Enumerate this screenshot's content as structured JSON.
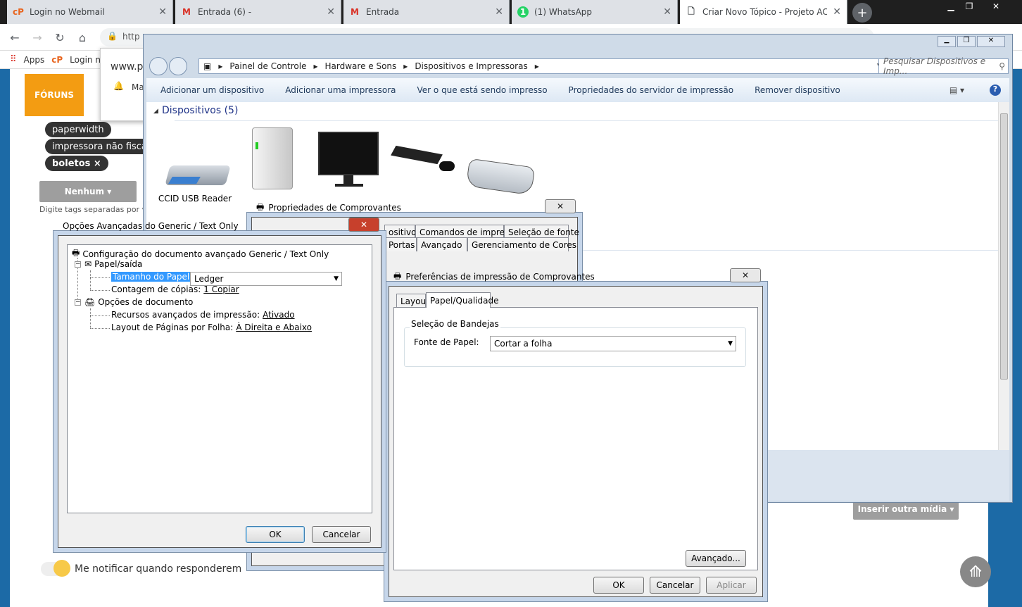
{
  "browser": {
    "tabs": [
      {
        "title": "Login no Webmail",
        "icon": "cp-icon",
        "color": "#e8651f"
      },
      {
        "title": "Entrada (6) - ",
        "icon": "gmail-icon",
        "color": "#d93025"
      },
      {
        "title": "Entrada",
        "icon": "gmail-icon",
        "color": "#d93025"
      },
      {
        "title": "(1) WhatsApp",
        "icon": "whatsapp-icon",
        "color": "#25d366"
      },
      {
        "title": "Criar Novo Tópico - Projeto ACBr",
        "icon": "page-icon",
        "color": "#5f6368"
      }
    ],
    "new_tab": "+",
    "url_prefix": "http",
    "bookmarks": {
      "apps": "Apps",
      "login": "Login n"
    }
  },
  "page": {
    "forum_button": "FÓRUNS",
    "popup": {
      "site": "www.p",
      "notif": "Ma"
    },
    "tags": [
      "paperwidth",
      "impressora não fiscal",
      "boletos ×"
    ],
    "nenhum": "Nenhum ▾",
    "tag_hint": "Digite tags separadas por v",
    "notify_label": "Me notificar quando responderem",
    "insert_media": "Inserir outra mídia ▾",
    "to_top": "⟰"
  },
  "explorer": {
    "breadcrumb": [
      "Painel de Controle",
      "Hardware e Sons",
      "Dispositivos e Impressoras"
    ],
    "search_placeholder": "Pesquisar Dispositivos e Imp...",
    "commands": [
      "Adicionar um dispositivo",
      "Adicionar uma impressora",
      "Ver o que está sendo impresso",
      "Propriedades do servidor de impressão",
      "Remover dispositivo"
    ],
    "group_title": "Dispositivos (5)",
    "devices": [
      {
        "name": "CCID USB Reader",
        "icon": "card-reader-icon"
      },
      {
        "name": "",
        "icon": "external-drive-icon"
      },
      {
        "name": "",
        "icon": "monitor-icon"
      },
      {
        "name": "",
        "icon": "keyboard-mouse-icon"
      },
      {
        "name": "",
        "icon": "keyboard-icon"
      }
    ]
  },
  "props_dialog": {
    "title": "Propriedades de Comprovantes",
    "tabs_row1": [
      "ositivo",
      "Comandos de impressora",
      "Seleção de fonte"
    ],
    "tabs_row2": [
      "Portas",
      "Avançado",
      "Gerenciamento de Cores"
    ]
  },
  "prefs_dialog": {
    "title": "Preferências de impressão de Comprovantes",
    "tabs": [
      "Layout",
      "Papel/Qualidade"
    ],
    "group": "Seleção de Bandejas",
    "source_label": "Fonte de Papel:",
    "source_value": "Cortar a folha",
    "advanced": "Avançado...",
    "ok": "OK",
    "cancel": "Cancelar",
    "apply": "Aplicar"
  },
  "adv_dialog": {
    "title": "Opções Avançadas do Generic / Text Only",
    "root": "Configuração do documento avançado Generic / Text Only",
    "paper_output": "Papel/saída",
    "paper_size_label": "Tamanho do Papel:",
    "paper_size_value": "Ledger",
    "copies_label": "Contagem de cópias:",
    "copies_value": "1 Copiar",
    "doc_options": "Opções de documento",
    "adv_features_label": "Recursos avançados de impressão:",
    "adv_features_value": "Ativado",
    "layout_label": "Layout de Páginas por Folha:",
    "layout_value": "À Direita e Abaixo",
    "ok": "OK",
    "cancel": "Cancelar"
  }
}
